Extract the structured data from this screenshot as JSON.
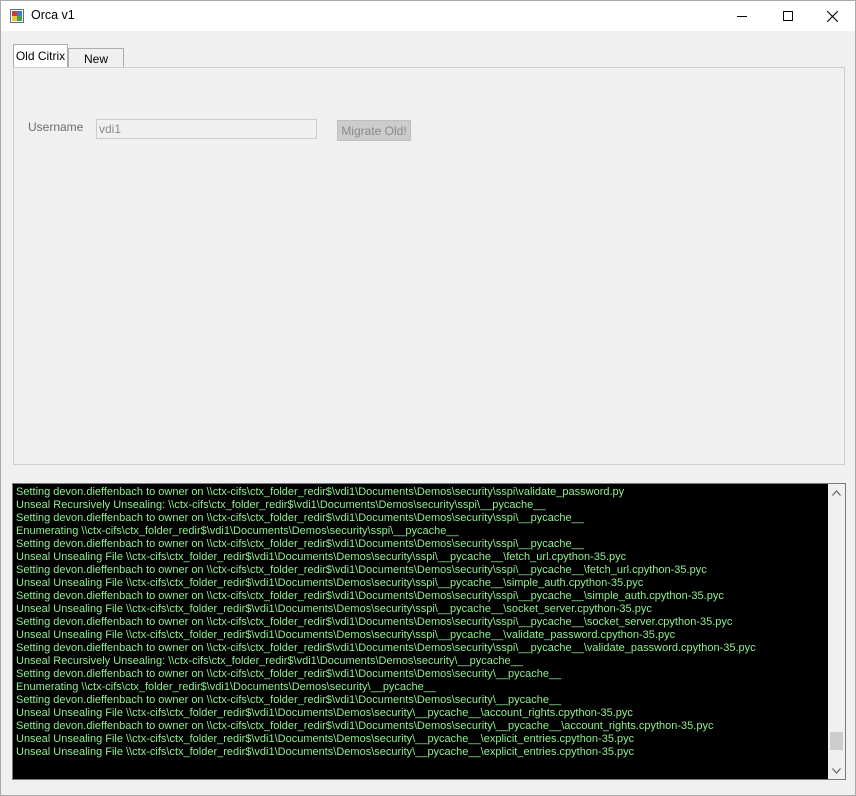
{
  "window": {
    "title": "Orca v1"
  },
  "tabs": [
    {
      "label": "Old Citrix",
      "active": true
    },
    {
      "label": "New Citrix",
      "active": false
    }
  ],
  "form": {
    "username_label": "Username",
    "username_value": "vdi1",
    "migrate_button": "Migrate Old!"
  },
  "log_lines": [
    "Setting devon.dieffenbach to owner on \\\\ctx-cifs\\ctx_folder_redir$\\vdi1\\Documents\\Demos\\security\\sspi\\validate_password.py",
    "Unseal Recursively Unsealing: \\\\ctx-cifs\\ctx_folder_redir$\\vdi1\\Documents\\Demos\\security\\sspi\\__pycache__",
    "Setting devon.dieffenbach to owner on \\\\ctx-cifs\\ctx_folder_redir$\\vdi1\\Documents\\Demos\\security\\sspi\\__pycache__",
    "Enumerating \\\\ctx-cifs\\ctx_folder_redir$\\vdi1\\Documents\\Demos\\security\\sspi\\__pycache__",
    "Setting devon.dieffenbach to owner on \\\\ctx-cifs\\ctx_folder_redir$\\vdi1\\Documents\\Demos\\security\\sspi\\__pycache__",
    "Unseal Unsealing File \\\\ctx-cifs\\ctx_folder_redir$\\vdi1\\Documents\\Demos\\security\\sspi\\__pycache__\\fetch_url.cpython-35.pyc",
    "Setting devon.dieffenbach to owner on \\\\ctx-cifs\\ctx_folder_redir$\\vdi1\\Documents\\Demos\\security\\sspi\\__pycache__\\fetch_url.cpython-35.pyc",
    "Unseal Unsealing File \\\\ctx-cifs\\ctx_folder_redir$\\vdi1\\Documents\\Demos\\security\\sspi\\__pycache__\\simple_auth.cpython-35.pyc",
    "Setting devon.dieffenbach to owner on \\\\ctx-cifs\\ctx_folder_redir$\\vdi1\\Documents\\Demos\\security\\sspi\\__pycache__\\simple_auth.cpython-35.pyc",
    "Unseal Unsealing File \\\\ctx-cifs\\ctx_folder_redir$\\vdi1\\Documents\\Demos\\security\\sspi\\__pycache__\\socket_server.cpython-35.pyc",
    "Setting devon.dieffenbach to owner on \\\\ctx-cifs\\ctx_folder_redir$\\vdi1\\Documents\\Demos\\security\\sspi\\__pycache__\\socket_server.cpython-35.pyc",
    "Unseal Unsealing File \\\\ctx-cifs\\ctx_folder_redir$\\vdi1\\Documents\\Demos\\security\\sspi\\__pycache__\\validate_password.cpython-35.pyc",
    "Setting devon.dieffenbach to owner on \\\\ctx-cifs\\ctx_folder_redir$\\vdi1\\Documents\\Demos\\security\\sspi\\__pycache__\\validate_password.cpython-35.pyc",
    "Unseal Recursively Unsealing: \\\\ctx-cifs\\ctx_folder_redir$\\vdi1\\Documents\\Demos\\security\\__pycache__",
    "Setting devon.dieffenbach to owner on \\\\ctx-cifs\\ctx_folder_redir$\\vdi1\\Documents\\Demos\\security\\__pycache__",
    "Enumerating \\\\ctx-cifs\\ctx_folder_redir$\\vdi1\\Documents\\Demos\\security\\__pycache__",
    "Setting devon.dieffenbach to owner on \\\\ctx-cifs\\ctx_folder_redir$\\vdi1\\Documents\\Demos\\security\\__pycache__",
    "Unseal Unsealing File \\\\ctx-cifs\\ctx_folder_redir$\\vdi1\\Documents\\Demos\\security\\__pycache__\\account_rights.cpython-35.pyc",
    "Setting devon.dieffenbach to owner on \\\\ctx-cifs\\ctx_folder_redir$\\vdi1\\Documents\\Demos\\security\\__pycache__\\account_rights.cpython-35.pyc",
    "Unseal Unsealing File \\\\ctx-cifs\\ctx_folder_redir$\\vdi1\\Documents\\Demos\\security\\__pycache__\\explicit_entries.cpython-35.pyc",
    "Unseal Unsealing File \\\\ctx-cifs\\ctx_folder_redir$\\vdi1\\Documents\\Demos\\security\\__pycache__\\explicit_entries.cpython-35.pyc"
  ],
  "colors": {
    "log_text": "#90ee90",
    "log_background": "#000000"
  },
  "icons": {
    "app": "app-icon",
    "minimize": "minimize-icon",
    "maximize": "maximize-icon",
    "close": "close-icon",
    "scroll_up": "chevron-up-icon",
    "scroll_down": "chevron-down-icon"
  },
  "scroll": {
    "position_fraction": 0.95
  }
}
